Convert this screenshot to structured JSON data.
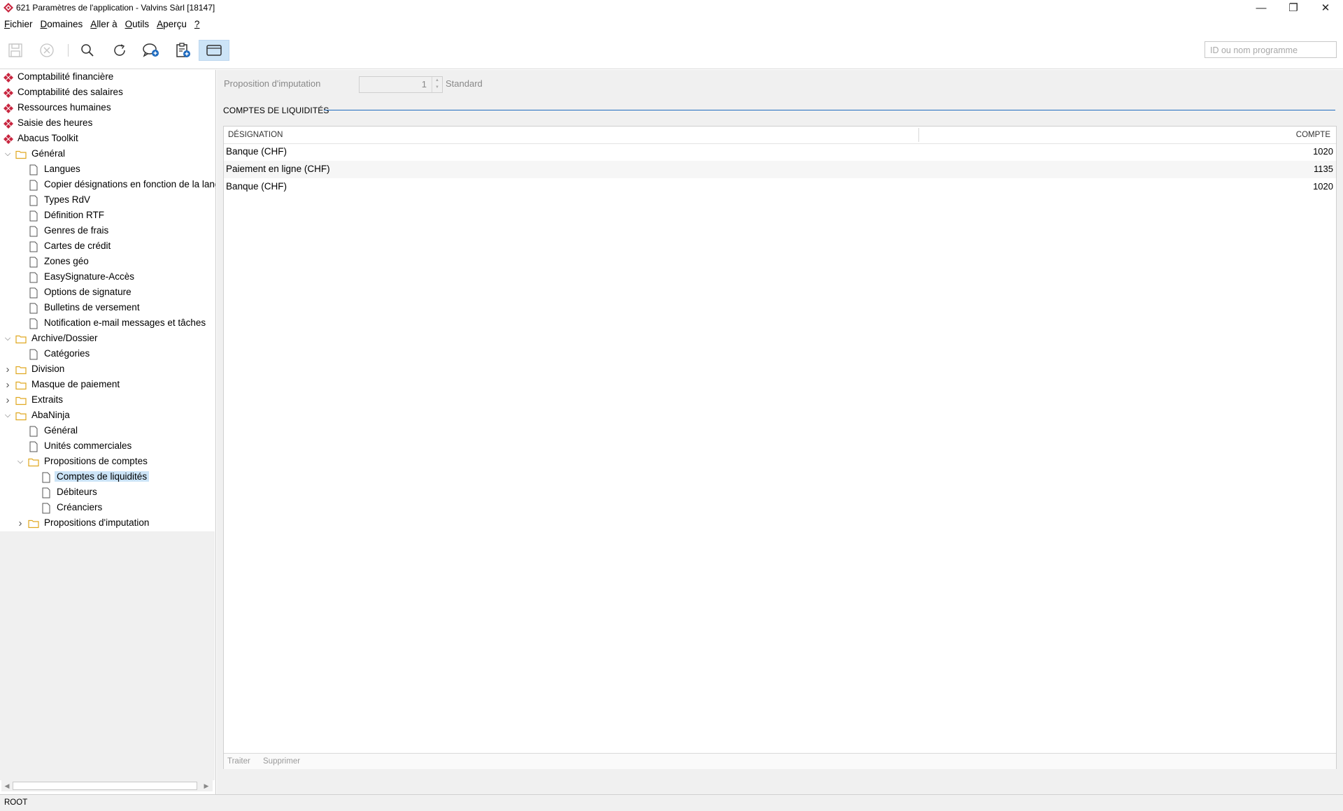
{
  "window": {
    "title": "621 Paramètres de l'application - Valvins Sàrl [18147]",
    "minimize_glyph": "—",
    "maximize_glyph": "❐",
    "close_glyph": "✕"
  },
  "menu": {
    "items": [
      {
        "mnemonic": "F",
        "rest": "ichier"
      },
      {
        "mnemonic": "D",
        "rest": "omaines"
      },
      {
        "mnemonic": "A",
        "rest": "ller à"
      },
      {
        "mnemonic": "O",
        "rest": "utils"
      },
      {
        "mnemonic": "A",
        "rest": "perçu"
      },
      {
        "mnemonic": "?",
        "rest": ""
      }
    ]
  },
  "toolbar": {
    "buttons": [
      "save-icon",
      "cancel-icon",
      "search-icon",
      "refresh-icon",
      "add-comment-icon",
      "clipboard-add-icon",
      "window-icon"
    ],
    "program_search_placeholder": "ID ou nom programme"
  },
  "sidebar": {
    "modules": [
      "Comptabilité financière",
      "Comptabilité des salaires",
      "Ressources humaines",
      "Saisie des heures",
      "Abacus Toolkit"
    ],
    "tree": [
      {
        "label": "Général",
        "level": 0,
        "type": "folder",
        "expand": "open"
      },
      {
        "label": "Langues",
        "level": 1,
        "type": "doc"
      },
      {
        "label": "Copier désignations en fonction de la langue",
        "level": 1,
        "type": "doc"
      },
      {
        "label": "Types RdV",
        "level": 1,
        "type": "doc"
      },
      {
        "label": "Définition RTF",
        "level": 1,
        "type": "doc"
      },
      {
        "label": "Genres de frais",
        "level": 1,
        "type": "doc"
      },
      {
        "label": "Cartes de crédit",
        "level": 1,
        "type": "doc"
      },
      {
        "label": "Zones géo",
        "level": 1,
        "type": "doc"
      },
      {
        "label": "EasySignature-Accès",
        "level": 1,
        "type": "doc"
      },
      {
        "label": "Options de signature",
        "level": 1,
        "type": "doc"
      },
      {
        "label": "Bulletins de versement",
        "level": 1,
        "type": "doc"
      },
      {
        "label": "Notification e-mail messages et tâches",
        "level": 1,
        "type": "doc"
      },
      {
        "label": "Archive/Dossier",
        "level": 0,
        "type": "folder",
        "expand": "open"
      },
      {
        "label": "Catégories",
        "level": 1,
        "type": "doc"
      },
      {
        "label": "Division",
        "level": 0,
        "type": "folder",
        "expand": "closed"
      },
      {
        "label": "Masque de paiement",
        "level": 0,
        "type": "folder",
        "expand": "closed"
      },
      {
        "label": "Extraits",
        "level": 0,
        "type": "folder",
        "expand": "closed"
      },
      {
        "label": "AbaNinja",
        "level": 0,
        "type": "folder",
        "expand": "open"
      },
      {
        "label": "Général",
        "level": 1,
        "type": "doc"
      },
      {
        "label": "Unités commerciales",
        "level": 1,
        "type": "doc"
      },
      {
        "label": "Propositions de comptes",
        "level": 1,
        "type": "folder",
        "expand": "open"
      },
      {
        "label": "Comptes de liquidités",
        "level": 2,
        "type": "doc",
        "selected": true
      },
      {
        "label": "Débiteurs",
        "level": 2,
        "type": "doc"
      },
      {
        "label": "Créanciers",
        "level": 2,
        "type": "doc"
      },
      {
        "label": "Propositions d'imputation",
        "level": 1,
        "type": "folder",
        "expand": "closed"
      }
    ]
  },
  "main": {
    "proposition_label": "Proposition d'imputation",
    "proposition_value": "1",
    "proposition_name": "Standard",
    "section_title": "COMPTES DE LIQUIDITÉS",
    "table": {
      "columns": [
        "DÉSIGNATION",
        "COMPTE"
      ],
      "rows": [
        {
          "designation": "Banque (CHF)",
          "compte": "1020"
        },
        {
          "designation": "Paiement en ligne (CHF)",
          "compte": "1135"
        },
        {
          "designation": "Banque (CHF)",
          "compte": "1020"
        }
      ]
    },
    "footer_actions": [
      "Traiter",
      "Supprimer"
    ]
  },
  "status_bar": {
    "text": "ROOT"
  },
  "colors": {
    "accent": "#1e6bbf",
    "selection": "#cce4f7",
    "folder": "#f0c24b",
    "module_icon": "#c8253f"
  }
}
